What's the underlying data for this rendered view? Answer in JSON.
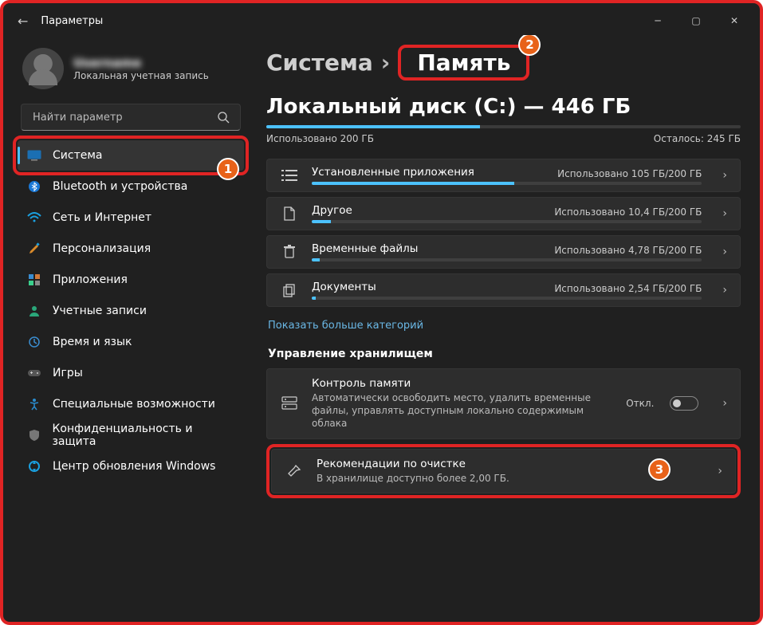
{
  "window": {
    "title": "Параметры"
  },
  "user": {
    "name": "Username",
    "sub": "Локальная учетная запись"
  },
  "search": {
    "placeholder": "Найти параметр"
  },
  "sidebar": {
    "items": [
      {
        "label": "Система"
      },
      {
        "label": "Bluetooth и устройства"
      },
      {
        "label": "Сеть и Интернет"
      },
      {
        "label": "Персонализация"
      },
      {
        "label": "Приложения"
      },
      {
        "label": "Учетные записи"
      },
      {
        "label": "Время и язык"
      },
      {
        "label": "Игры"
      },
      {
        "label": "Специальные возможности"
      },
      {
        "label": "Конфиденциальность и защита"
      },
      {
        "label": "Центр обновления Windows"
      }
    ]
  },
  "breadcrumb": {
    "parent": "Система",
    "current": "Память"
  },
  "disk": {
    "title": "Локальный диск (C:) — 446 ГБ",
    "used_pct": 45,
    "used_label": "Использовано 200 ГБ",
    "free_label": "Осталось: 245 ГБ"
  },
  "cats": [
    {
      "title": "Установленные приложения",
      "right": "Использовано 105 ГБ/200 ГБ",
      "pct": 52
    },
    {
      "title": "Другое",
      "right": "Использовано 10,4 ГБ/200 ГБ",
      "pct": 5
    },
    {
      "title": "Временные файлы",
      "right": "Использовано 4,78 ГБ/200 ГБ",
      "pct": 2
    },
    {
      "title": "Документы",
      "right": "Использовано 2,54 ГБ/200 ГБ",
      "pct": 1
    }
  ],
  "more_link": "Показать больше категорий",
  "section": "Управление хранилищем",
  "sense": {
    "title": "Контроль памяти",
    "sub": "Автоматически освободить место, удалить временные файлы, управлять доступным локально содержимым облака",
    "state": "Откл."
  },
  "rec": {
    "title": "Рекомендации по очистке",
    "sub": "В хранилище доступно более 2,00 ГБ."
  },
  "markers": {
    "m1": "1",
    "m2": "2",
    "m3": "3"
  }
}
